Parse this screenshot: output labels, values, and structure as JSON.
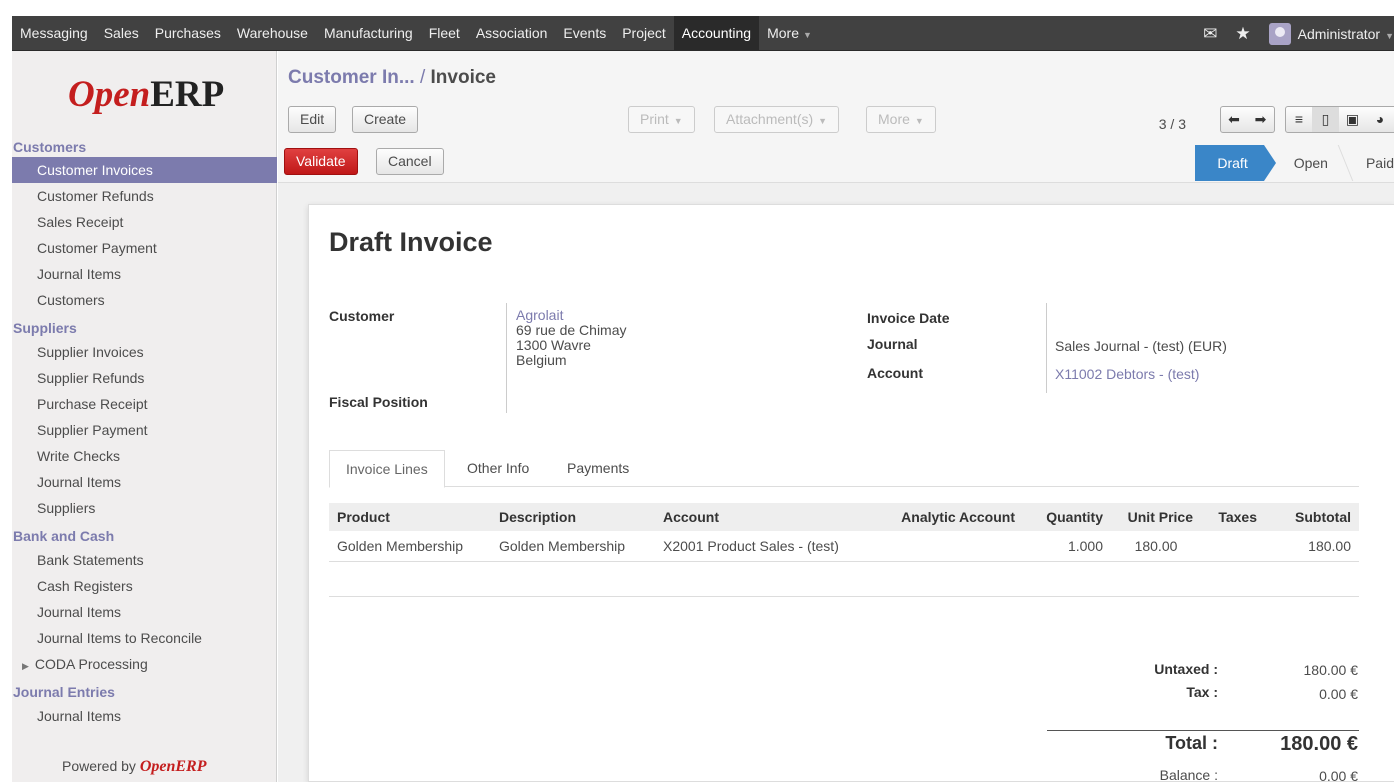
{
  "topbar": {
    "menu": [
      {
        "label": "Messaging"
      },
      {
        "label": "Sales"
      },
      {
        "label": "Purchases"
      },
      {
        "label": "Warehouse"
      },
      {
        "label": "Manufacturing"
      },
      {
        "label": "Fleet"
      },
      {
        "label": "Association"
      },
      {
        "label": "Events"
      },
      {
        "label": "Project"
      },
      {
        "label": "Accounting"
      },
      {
        "label": "More"
      }
    ],
    "active_menu": "Accounting",
    "user": "Administrator",
    "icons": [
      "mail-icon",
      "star-icon",
      "avatar"
    ]
  },
  "sidebar": {
    "logo_open": "Open",
    "logo_erp": "ERP",
    "sections": [
      {
        "title": "Customers",
        "items": [
          "Customer Invoices",
          "Customer Refunds",
          "Sales Receipt",
          "Customer Payment",
          "Journal Items",
          "Customers"
        ]
      },
      {
        "title": "Suppliers",
        "items": [
          "Supplier Invoices",
          "Supplier Refunds",
          "Purchase Receipt",
          "Supplier Payment",
          "Write Checks",
          "Journal Items",
          "Suppliers"
        ]
      },
      {
        "title": "Bank and Cash",
        "items": [
          "Bank Statements",
          "Cash Registers",
          "Journal Items",
          "Journal Items to Reconcile",
          "CODA Processing"
        ]
      },
      {
        "title": "Journal Entries",
        "items": [
          "Journal Items"
        ]
      }
    ],
    "active_item": "Customer Invoices",
    "powered_prefix": "Powered by",
    "powered_brand": "OpenERP"
  },
  "header": {
    "breadcrumb_parent": "Customer In...",
    "breadcrumb_sep": "/",
    "breadcrumb_current": "Invoice",
    "edit": "Edit",
    "create": "Create",
    "print": "Print",
    "attachments": "Attachment(s)",
    "more": "More",
    "pager": "3 / 3",
    "validate": "Validate",
    "cancel": "Cancel",
    "states": [
      "Draft",
      "Open",
      "Paid"
    ],
    "active_state": "Draft"
  },
  "form": {
    "title": "Draft Invoice",
    "customer_label": "Customer",
    "customer_name": "Agrolait",
    "customer_address": [
      "69 rue de Chimay",
      "1300 Wavre",
      "Belgium"
    ],
    "fiscal_position_label": "Fiscal Position",
    "invoice_date_label": "Invoice Date",
    "journal_label": "Journal",
    "journal_value": "Sales Journal - (test) (EUR)",
    "account_label": "Account",
    "account_value": "X11002 Debtors - (test)"
  },
  "tabs": [
    "Invoice Lines",
    "Other Info",
    "Payments"
  ],
  "lines": {
    "columns": [
      "Product",
      "Description",
      "Account",
      "Analytic Account",
      "Quantity",
      "Unit Price",
      "Taxes",
      "Subtotal"
    ],
    "rows": [
      {
        "product": "Golden Membership",
        "description": "Golden Membership",
        "account": "X2001 Product Sales - (test)",
        "analytic": "",
        "quantity": "1.000",
        "unit_price": "180.00",
        "taxes": "",
        "subtotal": "180.00"
      }
    ]
  },
  "totals": {
    "untaxed_label": "Untaxed :",
    "untaxed_value": "180.00 €",
    "tax_label": "Tax :",
    "tax_value": "0.00 €",
    "total_label": "Total :",
    "total_value": "180.00 €",
    "balance_label": "Balance :",
    "balance_value": "0.00 €"
  },
  "colors": {
    "accent": "#7c7bad",
    "topbar": "#414141",
    "validate": "#c92a2a",
    "status_active": "#3a86c8",
    "brand_red": "#c41e1e"
  }
}
